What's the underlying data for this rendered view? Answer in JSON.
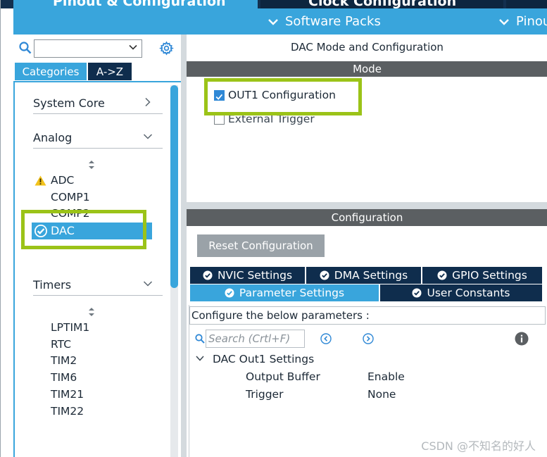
{
  "top_tabs": {
    "pinout_config": "Pinout & Configuration",
    "clock_config": "Clock Configuration"
  },
  "sub_bar": {
    "software_packs": "Software Packs",
    "pinout": "Pinout"
  },
  "left_panel": {
    "tabs": {
      "categories": "Categories",
      "az": "A->Z"
    },
    "groups": {
      "system_core": "System Core",
      "analog": "Analog",
      "timers": "Timers"
    },
    "analog_items": [
      "ADC",
      "COMP1",
      "COMP2",
      "DAC"
    ],
    "timer_items": [
      "LPTIM1",
      "RTC",
      "TIM2",
      "TIM6",
      "TIM21",
      "TIM22"
    ]
  },
  "right_panel": {
    "title": "DAC Mode and Configuration",
    "mode_header": "Mode",
    "out1_config": "OUT1 Configuration",
    "out1_checked": true,
    "external_trigger": "External Trigger",
    "external_trigger_checked": false,
    "config_header": "Configuration",
    "reset_button": "Reset Configuration",
    "tabs": {
      "nvic": "NVIC Settings",
      "dma": "DMA Settings",
      "gpio": "GPIO Settings",
      "parameter": "Parameter Settings",
      "user_constants": "User Constants"
    },
    "hint": "Configure the below parameters :",
    "search_placeholder": "Search (Crtl+F)",
    "param_group": "DAC Out1 Settings",
    "params": [
      {
        "name": "Output Buffer",
        "value": "Enable"
      },
      {
        "name": "Trigger",
        "value": "None"
      }
    ]
  },
  "watermark": "CSDN @不知名的好人",
  "colors": {
    "accent_blue": "#39a5dc",
    "navy": "#0f2d4d",
    "header_gray": "#5b5f62",
    "highlight_green": "#9bc318"
  }
}
